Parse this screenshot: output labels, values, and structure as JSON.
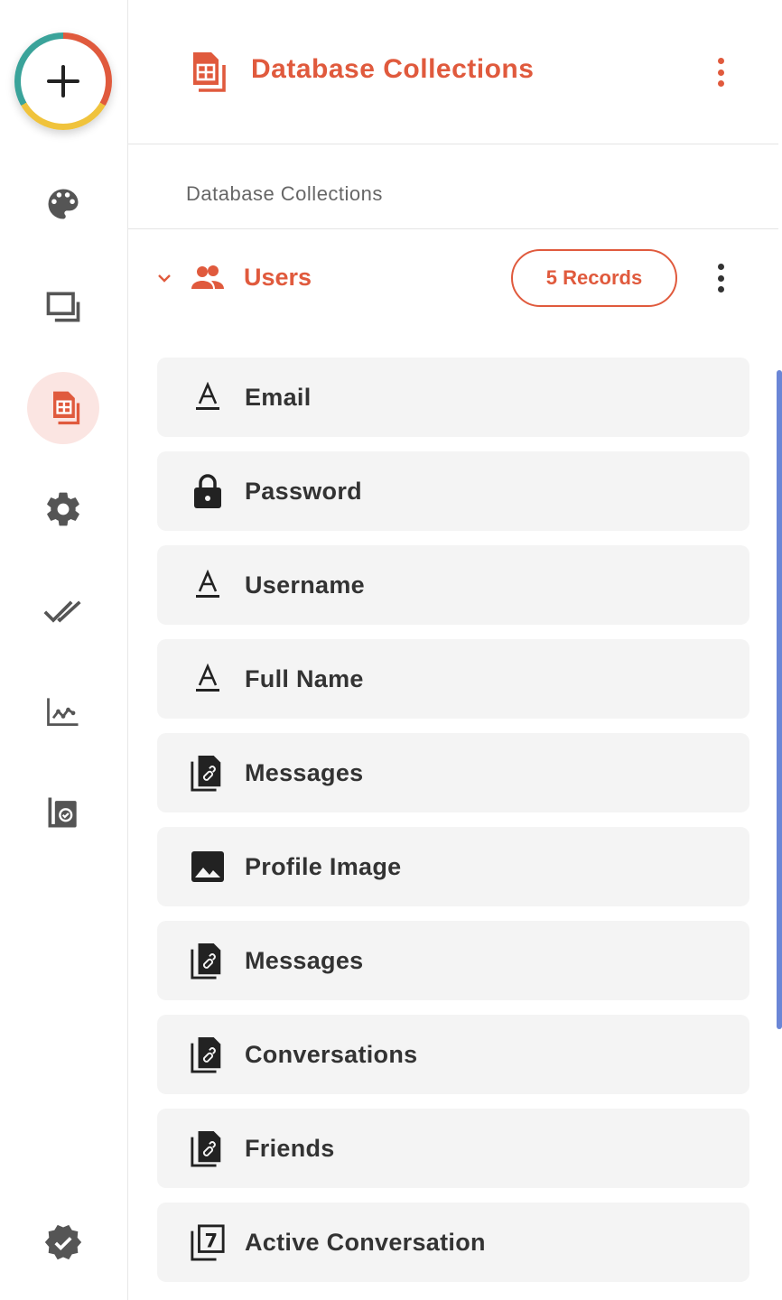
{
  "header": {
    "title": "Database Collections",
    "icon": "spreadsheet-icon",
    "accent": "#e05a3d"
  },
  "subtitle": "Database Collections",
  "collection": {
    "name": "Users",
    "icon": "users-icon",
    "expanded": true,
    "records_badge": "5 Records"
  },
  "fields": [
    {
      "label": "Email",
      "icon": "text-field-icon"
    },
    {
      "label": "Password",
      "icon": "lock-icon"
    },
    {
      "label": "Username",
      "icon": "text-field-icon"
    },
    {
      "label": "Full Name",
      "icon": "text-field-icon"
    },
    {
      "label": "Messages",
      "icon": "linked-docs-icon"
    },
    {
      "label": "Profile Image",
      "icon": "image-icon"
    },
    {
      "label": "Messages",
      "icon": "linked-docs-icon"
    },
    {
      "label": "Conversations",
      "icon": "linked-docs-icon"
    },
    {
      "label": "Friends",
      "icon": "linked-docs-icon"
    },
    {
      "label": "Active Conversation",
      "icon": "single-reference-icon"
    }
  ],
  "rail": {
    "items": [
      {
        "icon": "palette-icon",
        "active": false
      },
      {
        "icon": "layers-icon",
        "active": false
      },
      {
        "icon": "database-icon",
        "active": true
      },
      {
        "icon": "gear-icon",
        "active": false
      },
      {
        "icon": "double-check-icon",
        "active": false
      },
      {
        "icon": "analytics-icon",
        "active": false
      },
      {
        "icon": "verified-docs-icon",
        "active": false
      },
      {
        "icon": "verified-badge-icon",
        "active": false
      }
    ]
  },
  "colors": {
    "accent": "#e05a3d",
    "field_bg": "#f4f4f4",
    "active_rail_bg": "#fbe5e2",
    "scrollbar": "#6b86d6"
  }
}
